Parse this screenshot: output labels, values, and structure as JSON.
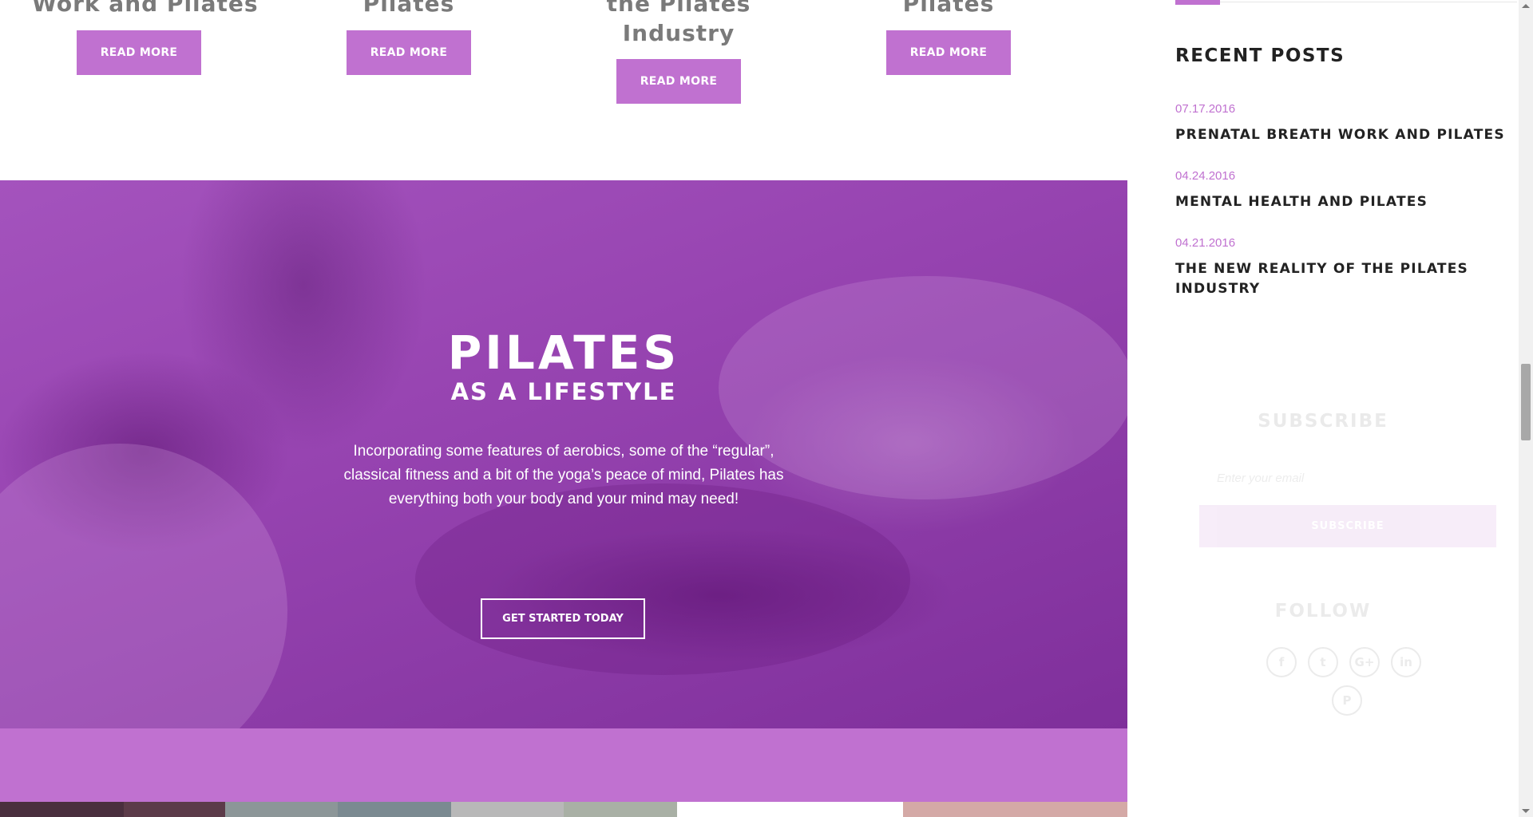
{
  "colors": {
    "accent": "#c071d0",
    "hero_overlay": "#9744b1",
    "heading_dark": "#222222",
    "post_title_gray": "#7a7a7a"
  },
  "posts": [
    {
      "title_lines": [
        "Work and Pilates"
      ],
      "read_more": "READ MORE"
    },
    {
      "title_lines": [
        "Pilates"
      ],
      "read_more": "READ MORE"
    },
    {
      "title_lines": [
        "the Pilates",
        "Industry"
      ],
      "read_more": "READ MORE"
    },
    {
      "title_lines": [
        "Pilates"
      ],
      "read_more": "READ MORE"
    }
  ],
  "hero": {
    "title": "PILATES",
    "subtitle": "AS A LIFESTYLE",
    "text": "Incorporating some features of aerobics, some of the “regular”, classical fitness and a bit of the yoga’s peace of mind, Pilates has everything both your body and your mind may need!",
    "button": "GET STARTED TODAY"
  },
  "sidebar": {
    "recent_posts_heading": "RECENT POSTS",
    "recent_posts": [
      {
        "date": "07.17.2016",
        "title": "PRENATAL BREATH WORK AND PILATES"
      },
      {
        "date": "04.24.2016",
        "title": "MENTAL HEALTH AND PILATES"
      },
      {
        "date": "04.21.2016",
        "title": "THE NEW REALITY OF THE PILATES INDUSTRY"
      }
    ],
    "subscribe": {
      "heading": "SUBSCRIBE",
      "placeholder": "Enter your email",
      "button": "SUBSCRIBE"
    },
    "follow": {
      "heading": "FOLLOW",
      "icons": [
        {
          "name": "facebook-icon",
          "glyph": "f"
        },
        {
          "name": "twitter-icon",
          "glyph": "t"
        },
        {
          "name": "google-plus-icon",
          "glyph": "G+"
        },
        {
          "name": "linkedin-icon",
          "glyph": "in"
        },
        {
          "name": "pinterest-icon",
          "glyph": "P"
        }
      ]
    }
  },
  "gallery": [
    {
      "color": "#4a2f3e"
    },
    {
      "color": "#5c3b49"
    },
    {
      "color": "#8c9698"
    },
    {
      "color": "#7b8a91"
    },
    {
      "color": "#b8b8b8"
    },
    {
      "color": "#a9b0a5"
    },
    {
      "color": "#ffffff"
    },
    {
      "color": "#d4a9a6"
    }
  ]
}
